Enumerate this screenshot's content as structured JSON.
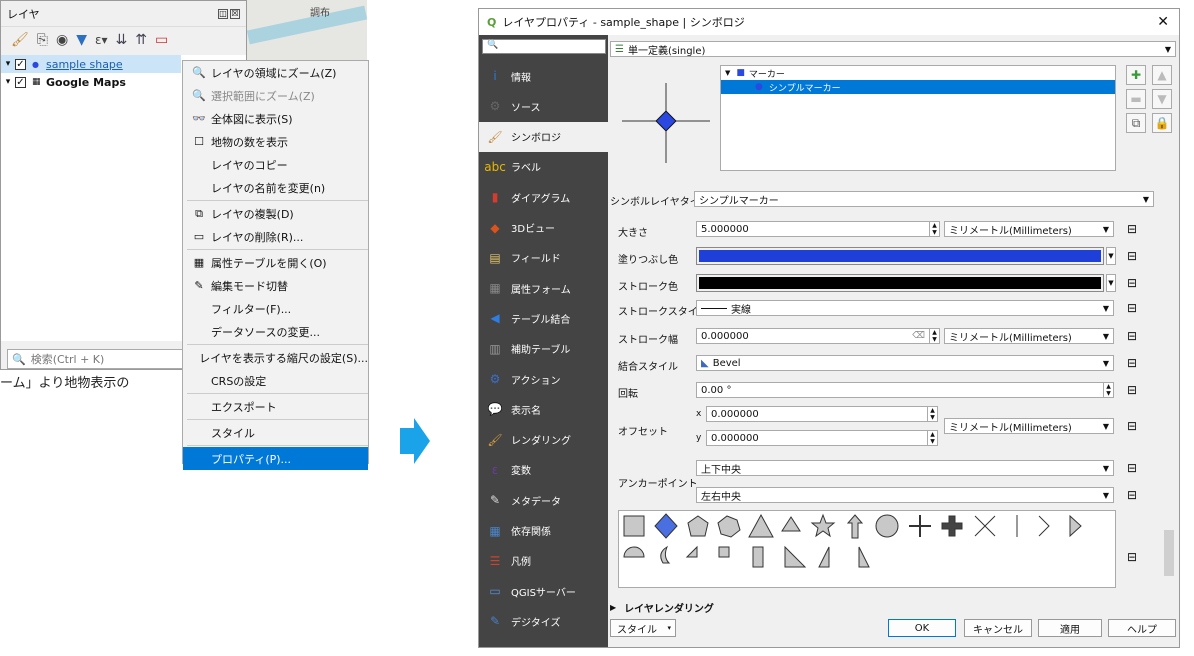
{
  "layers_panel": {
    "title": "レイヤ",
    "title_controls": [
      "◫",
      "☒"
    ],
    "toolbar_icons": [
      "paint-brush-icon",
      "add-group-icon",
      "eye-icon",
      "filter-icon",
      "filter-legend-icon",
      "expand-icon",
      "collapse-icon",
      "remove-layer-icon"
    ],
    "layers": [
      {
        "name": "sample shape",
        "checked": true,
        "selected": true,
        "expander": "▾"
      },
      {
        "name": "Google Maps",
        "checked": true,
        "selected": false,
        "expander": "▾"
      }
    ],
    "search_placeholder": "検索(Ctrl + K)",
    "map_city_label": "調布",
    "bottom_text": "ーム」より地物表示の"
  },
  "context_menu": {
    "items": [
      {
        "label": "レイヤの領域にズーム(Z)",
        "icon": "zoom-layer-icon",
        "disabled": false
      },
      {
        "label": "選択範囲にズーム(Z)",
        "icon": "zoom-selection-icon",
        "disabled": true
      },
      {
        "label": "全体図に表示(S)",
        "icon": "overview-icon",
        "disabled": false
      },
      {
        "label": "地物の数を表示",
        "icon": "checkbox-icon",
        "disabled": false
      },
      {
        "label": "レイヤのコピー",
        "icon": "",
        "disabled": false
      },
      {
        "label": "レイヤの名前を変更(n)",
        "icon": "",
        "disabled": false,
        "sep_after": true
      },
      {
        "label": "レイヤの複製(D)",
        "icon": "duplicate-icon",
        "disabled": false
      },
      {
        "label": "レイヤの削除(R)...",
        "icon": "remove-icon",
        "disabled": false,
        "sep_after": true
      },
      {
        "label": "属性テーブルを開く(O)",
        "icon": "table-icon",
        "disabled": false
      },
      {
        "label": "編集モード切替",
        "icon": "pencil-icon",
        "disabled": false
      },
      {
        "label": "フィルター(F)...",
        "icon": "",
        "disabled": false
      },
      {
        "label": "データソースの変更...",
        "icon": "",
        "disabled": false,
        "sep_after": true
      },
      {
        "label": "レイヤを表示する縮尺の設定(S)...",
        "icon": "",
        "disabled": false
      },
      {
        "label": "CRSの設定",
        "icon": "",
        "disabled": false,
        "sep_after": true
      },
      {
        "label": "エクスポート",
        "icon": "",
        "disabled": false,
        "sep_after": true
      },
      {
        "label": "スタイル",
        "icon": "",
        "disabled": false,
        "sep_after": true
      },
      {
        "label": "プロパティ(P)...",
        "icon": "",
        "disabled": false,
        "selected": true
      }
    ]
  },
  "dialog": {
    "title": "レイヤプロパティ - sample_shape | シンボロジ",
    "close": "✕",
    "sidebar": [
      {
        "label": "情報",
        "icon": "info-icon",
        "color": "#2a7bd4",
        "glyph": "i"
      },
      {
        "label": "ソース",
        "icon": "source-icon",
        "color": "#666",
        "glyph": "⚙"
      },
      {
        "label": "シンボロジ",
        "icon": "symbology-icon",
        "color": "#c08a3e",
        "glyph": "🖌",
        "active": true
      },
      {
        "label": "ラベル",
        "icon": "labels-icon",
        "color": "#e8b800",
        "glyph": "abc"
      },
      {
        "label": "ダイアグラム",
        "icon": "diagram-icon",
        "color": "#d63b2f",
        "glyph": "▮"
      },
      {
        "label": "3Dビュー",
        "icon": "3d-view-icon",
        "color": "#d9531e",
        "glyph": "◆"
      },
      {
        "label": "フィールド",
        "icon": "fields-icon",
        "color": "#e0c46a",
        "glyph": "▤"
      },
      {
        "label": "属性フォーム",
        "icon": "attribute-form-icon",
        "color": "#888",
        "glyph": "▦"
      },
      {
        "label": "テーブル結合",
        "icon": "join-icon",
        "color": "#2f7de0",
        "glyph": "◀"
      },
      {
        "label": "補助テーブル",
        "icon": "aux-storage-icon",
        "color": "#999",
        "glyph": "▥"
      },
      {
        "label": "アクション",
        "icon": "action-icon",
        "color": "#3c6fc9",
        "glyph": "⚙"
      },
      {
        "label": "表示名",
        "icon": "display-icon",
        "color": "#f0c040",
        "glyph": "💬"
      },
      {
        "label": "レンダリング",
        "icon": "rendering-icon",
        "color": "#d8a040",
        "glyph": "🖌"
      },
      {
        "label": "変数",
        "icon": "variables-icon",
        "color": "#6a3d9a",
        "glyph": "ε"
      },
      {
        "label": "メタデータ",
        "icon": "metadata-icon",
        "color": "#ddd",
        "glyph": "✎"
      },
      {
        "label": "依存関係",
        "icon": "dependencies-icon",
        "color": "#4a86c9",
        "glyph": "▦"
      },
      {
        "label": "凡例",
        "icon": "legend-icon",
        "color": "#c9452f",
        "glyph": "☰"
      },
      {
        "label": "QGISサーバー",
        "icon": "qgis-server-icon",
        "color": "#5a8ed6",
        "glyph": "▭"
      },
      {
        "label": "デジタイズ",
        "icon": "digitizing-icon",
        "color": "#4a80c8",
        "glyph": "✎"
      }
    ],
    "renderer_combo": "単一定義(single)",
    "symbol_tree": [
      {
        "label": "マーカー",
        "level": 0,
        "selected": false
      },
      {
        "label": "シンプルマーカー",
        "level": 1,
        "selected": true
      }
    ],
    "symbol_layer_type_label": "シンボルレイヤタイプ",
    "symbol_layer_type_value": "シンプルマーカー",
    "size_label": "大きさ",
    "size_value": "5.000000",
    "size_unit": "ミリメートル(Millimeters)",
    "fill_color_label": "塗りつぶし色",
    "fill_color": "#1e3fd8",
    "stroke_color_label": "ストローク色",
    "stroke_color": "#000000",
    "stroke_style_label": "ストロークスタイル",
    "stroke_style_value": "実線",
    "stroke_width_label": "ストローク幅",
    "stroke_width_value": "0.000000",
    "stroke_width_unit": "ミリメートル(Millimeters)",
    "join_style_label": "結合スタイル",
    "join_style_value": "Bevel",
    "rotation_label": "回転",
    "rotation_value": "0.00 °",
    "offset_label": "オフセット",
    "offset_x_label": "x",
    "offset_x_value": "0.000000",
    "offset_y_label": "y",
    "offset_y_value": "0.000000",
    "offset_unit": "ミリメートル(Millimeters)",
    "anchor_label": "アンカーポイント",
    "anchor_v_value": "上下中央",
    "anchor_h_value": "左右中央",
    "shapes": [
      "square",
      "diamond",
      "pentagon",
      "hexagon",
      "triangle",
      "equilateral-triangle",
      "star",
      "arrow",
      "circle",
      "cross",
      "cross-fill",
      "x",
      "line",
      "arrowhead",
      "filled-arrowhead",
      "half-circle",
      "crescent",
      "quarter-triangle",
      "quarter-square",
      "half-square",
      "diagonal-half-square",
      "right-half-triangle",
      "left-half-triangle"
    ],
    "layer_rendering_label": "レイヤレンダリング",
    "style_button": "スタイル",
    "ok_button": "OK",
    "cancel_button": "キャンセル",
    "apply_button": "適用",
    "help_button": "ヘルプ"
  },
  "colors": {
    "selection_blue": "#0078d7",
    "sidebar_bg": "#444444",
    "arrow_cyan": "#1aa3e8",
    "marker_blue": "#2b48e0"
  }
}
